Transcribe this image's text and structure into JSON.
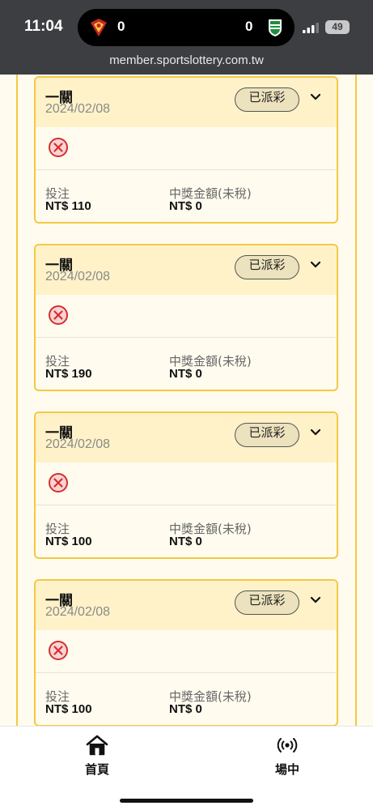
{
  "status_bar": {
    "time": "11:04",
    "home_score": "0",
    "away_score": "0",
    "battery": "49",
    "url": "member.sportslottery.com.tw"
  },
  "colors": {
    "accent_border": "#f5c842",
    "card_header_bg": "#fff2c9",
    "lose_icon": "#d32f2f"
  },
  "bets": [
    {
      "title": "一關",
      "date": "2024/02/08",
      "status": "已派彩",
      "result_icon": "lose-x-icon",
      "stake_label": "投注",
      "stake": "NT$ 110",
      "payout_label": "中獎金額(未稅)",
      "payout": "NT$ 0"
    },
    {
      "title": "一關",
      "date": "2024/02/08",
      "status": "已派彩",
      "result_icon": "lose-x-icon",
      "stake_label": "投注",
      "stake": "NT$ 190",
      "payout_label": "中獎金額(未稅)",
      "payout": "NT$ 0"
    },
    {
      "title": "一關",
      "date": "2024/02/08",
      "status": "已派彩",
      "result_icon": "lose-x-icon",
      "stake_label": "投注",
      "stake": "NT$ 100",
      "payout_label": "中獎金額(未稅)",
      "payout": "NT$ 0"
    },
    {
      "title": "一關",
      "date": "2024/02/08",
      "status": "已派彩",
      "result_icon": "lose-x-icon",
      "stake_label": "投注",
      "stake": "NT$ 100",
      "payout_label": "中獎金額(未稅)",
      "payout": "NT$ 0"
    }
  ],
  "bottom_nav": {
    "home_label": "首頁",
    "home_icon": "home-icon",
    "live_label": "場中",
    "live_icon": "broadcast-icon"
  }
}
